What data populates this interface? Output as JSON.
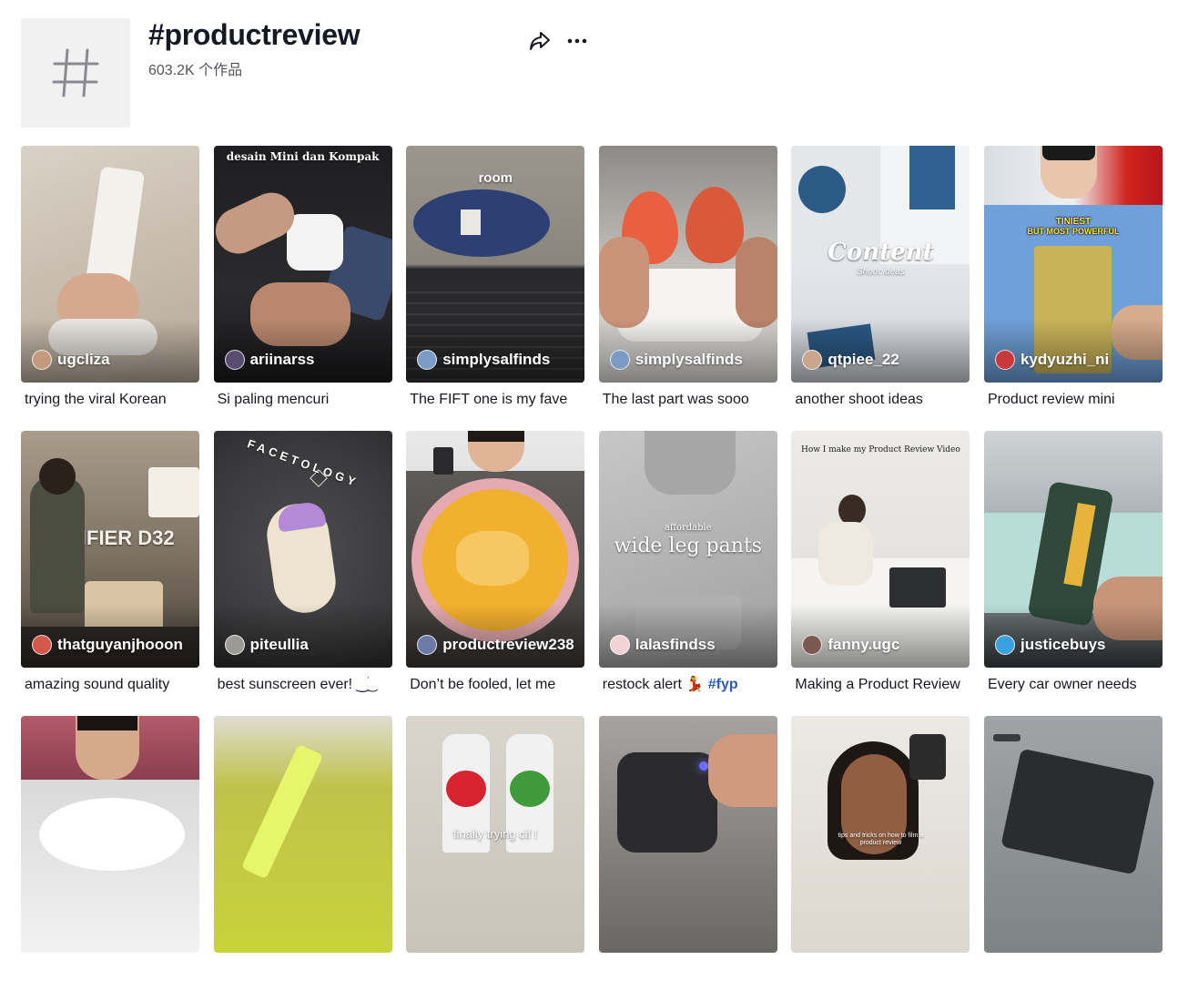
{
  "header": {
    "title": "#productreview",
    "count": "603.2K 个作品"
  },
  "videos": [
    {
      "author": "ugcliza",
      "caption": "trying the viral Korean",
      "overlay": ""
    },
    {
      "author": "ariinarss",
      "caption": "Si paling mencuri",
      "overlay": "desain Mini dan Kompak"
    },
    {
      "author": "simplysalfinds",
      "caption": "The FIFT one is my fave",
      "overlay": "room"
    },
    {
      "author": "simplysalfinds",
      "caption": "The last part was sooo",
      "overlay": ""
    },
    {
      "author": "qtpiee_22",
      "caption": "another shoot ideas",
      "overlay": "Content",
      "overlay_sub": "Shoot ideas"
    },
    {
      "author": "kydyuzhi_ni",
      "caption": "Product review mini",
      "overlay": "TINIEST",
      "overlay_sub": "BUT MOST POWERFUL"
    },
    {
      "author": "thatguyanjhooon",
      "caption": "amazing sound quality",
      "overlay": "DIFIER D32"
    },
    {
      "author": "piteullia",
      "caption": "best sunscreen ever! ‿ׂ͜",
      "overlay": "FACETOLOGY"
    },
    {
      "author": "productreview238",
      "caption": "Don’t be fooled, let me",
      "overlay": ""
    },
    {
      "author": "lalasfindss",
      "caption": "restock alert 💃 ",
      "caption_tag": "#fyp",
      "overlay": "wide leg pants",
      "overlay_sub": "affordable"
    },
    {
      "author": "fanny.ugc",
      "caption": "Making a Product Review",
      "overlay": "How I make my Product Review Video"
    },
    {
      "author": "justicebuys",
      "caption": "Every car owner needs",
      "overlay": ""
    },
    {
      "author": "",
      "caption": "",
      "overlay": ""
    },
    {
      "author": "",
      "caption": "",
      "overlay": ""
    },
    {
      "author": "",
      "caption": "",
      "overlay": "finally trying cif !"
    },
    {
      "author": "",
      "caption": "",
      "overlay": ""
    },
    {
      "author": "",
      "caption": "",
      "overlay": "tips and tricks on how to film a product review"
    },
    {
      "author": "",
      "caption": "",
      "overlay": ""
    }
  ],
  "colors": {
    "text": "#161823",
    "muted": "#6b6d75",
    "tag": "#2b5db9",
    "avatar_bg": "#f1f1f2"
  },
  "icons": {
    "header": "hashtag-icon",
    "share": "share-arrow-icon",
    "more": "more-dots-icon"
  }
}
